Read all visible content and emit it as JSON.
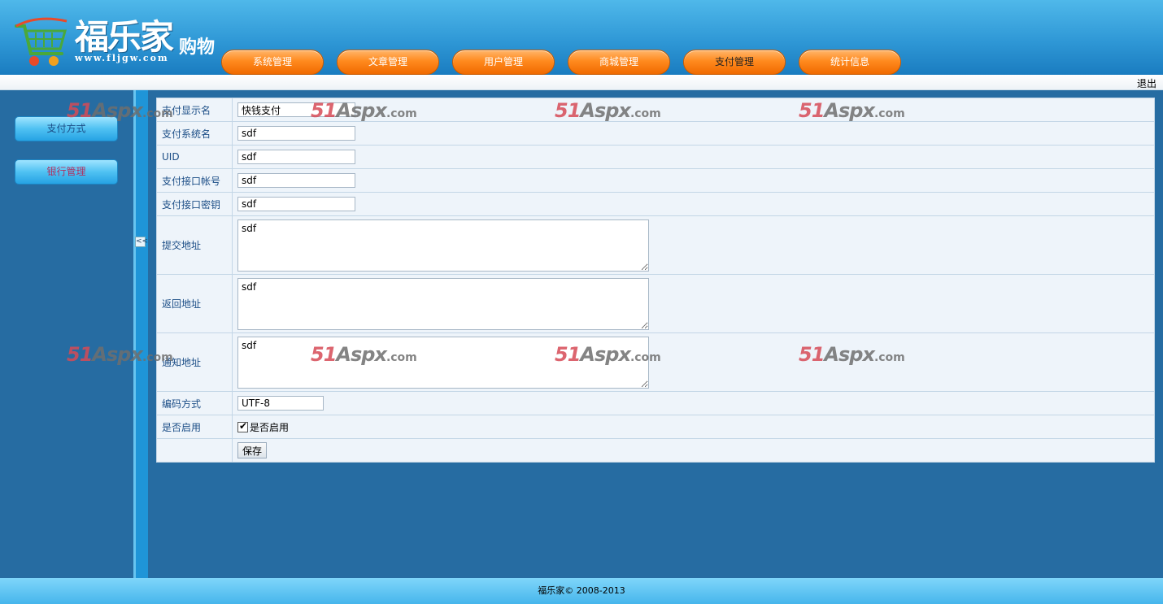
{
  "brand": {
    "name": "福乐家",
    "suffix": "购物",
    "domain": "www.fljgw.com"
  },
  "nav": {
    "items": [
      {
        "label": "系统管理"
      },
      {
        "label": "文章管理"
      },
      {
        "label": "用户管理"
      },
      {
        "label": "商城管理"
      },
      {
        "label": "支付管理"
      },
      {
        "label": "统计信息"
      }
    ],
    "active_index": 4
  },
  "topbar": {
    "logout": "退出"
  },
  "sidebar": {
    "items": [
      {
        "label": "支付方式"
      },
      {
        "label": "银行管理"
      }
    ]
  },
  "splitter": {
    "toggle": "<<"
  },
  "form": {
    "display_name_label": "支付显示名",
    "display_name_value": "快钱支付",
    "system_name_label": "支付系统名",
    "system_name_value": "sdf",
    "uid_label": "UID",
    "uid_value": "sdf",
    "account_label": "支付接口帐号",
    "account_value": "sdf",
    "key_label": "支付接口密钥",
    "key_value": "sdf",
    "submit_url_label": "提交地址",
    "submit_url_value": "sdf",
    "return_url_label": "返回地址",
    "return_url_value": "sdf",
    "notify_url_label": "通知地址",
    "notify_url_value": "sdf",
    "encoding_label": "编码方式",
    "encoding_value": "UTF-8",
    "enabled_label": "是否启用",
    "enabled_checkbox_label": "是否启用",
    "enabled": true,
    "save_label": "保存"
  },
  "watermark": {
    "part1": "51",
    "part2": "Aspx",
    "part3": ".com"
  },
  "footer": {
    "copyright": "福乐家© 2008-2013"
  }
}
